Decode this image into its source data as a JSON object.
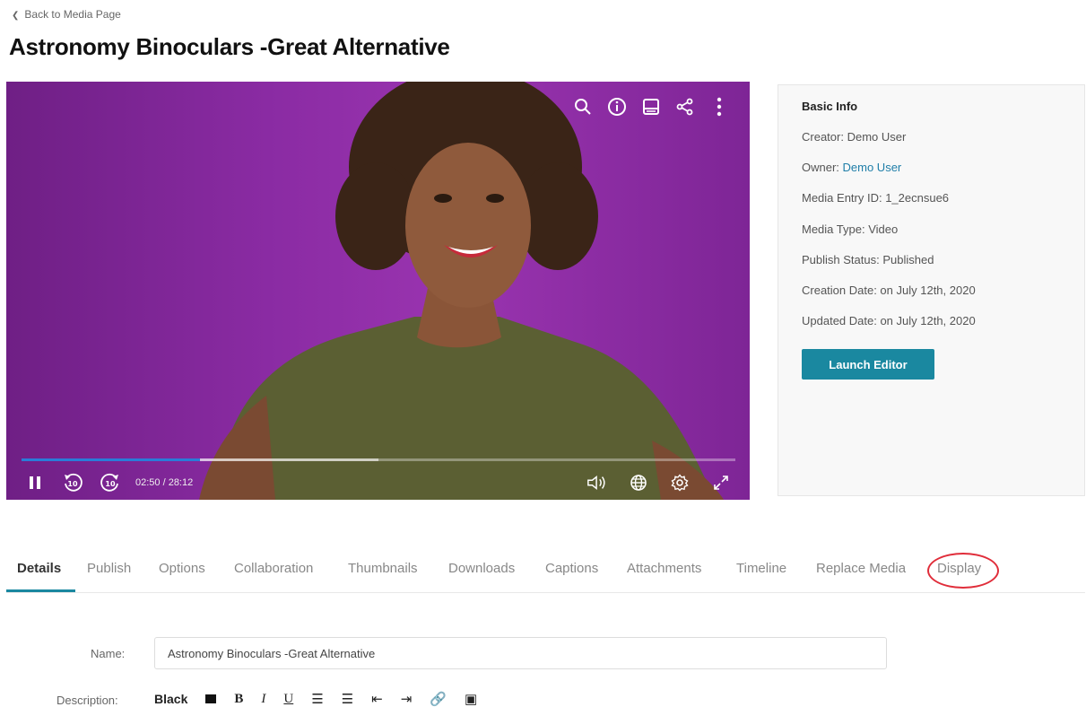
{
  "nav": {
    "back_label": "Back to Media Page"
  },
  "page": {
    "title": "Astronomy Binoculars -Great Alternative"
  },
  "player": {
    "time": "02:50 / 28:12",
    "progress_played_fraction": 0.25,
    "progress_buffered_fraction": 0.5,
    "top_icons": [
      "search-icon",
      "info-icon",
      "transcript-icon",
      "share-icon",
      "more-options-icon"
    ],
    "bottom_icons": [
      "pause-icon",
      "rewind-10-icon",
      "forward-10-icon",
      "volume-icon",
      "language-icon",
      "settings-icon",
      "fullscreen-icon"
    ],
    "rewind_label": "10",
    "forward_label": "10"
  },
  "info": {
    "heading": "Basic Info",
    "creator": "Creator: Demo User",
    "owner_prefix": "Owner: ",
    "owner_name": "Demo User",
    "entry_id": "Media Entry ID: 1_2ecnsue6",
    "media_type": "Media Type: Video",
    "publish_status": "Publish Status: Published",
    "creation_date": "Creation Date: on July 12th, 2020",
    "updated_date": "Updated Date: on July 12th, 2020",
    "launch_editor": "Launch Editor"
  },
  "tabs": [
    {
      "label": "Details",
      "active": true
    },
    {
      "label": "Publish"
    },
    {
      "label": "Options"
    },
    {
      "label": "Collaboration"
    },
    {
      "label": "Thumbnails"
    },
    {
      "label": "Downloads"
    },
    {
      "label": "Captions"
    },
    {
      "label": "Attachments"
    },
    {
      "label": "Timeline"
    },
    {
      "label": "Replace Media"
    },
    {
      "label": "Display"
    }
  ],
  "form": {
    "name_label": "Name:",
    "name_value": "Astronomy Binoculars -Great Alternative",
    "description_label": "Description:",
    "toolbar": {
      "color": "Black",
      "bold": "B",
      "italic": "I",
      "underline": "U"
    }
  },
  "colors": {
    "accent": "#1a88a0",
    "highlight": "#e02d3a",
    "progress": "#2a7cd8",
    "video_bg": "#8a2ba3"
  }
}
